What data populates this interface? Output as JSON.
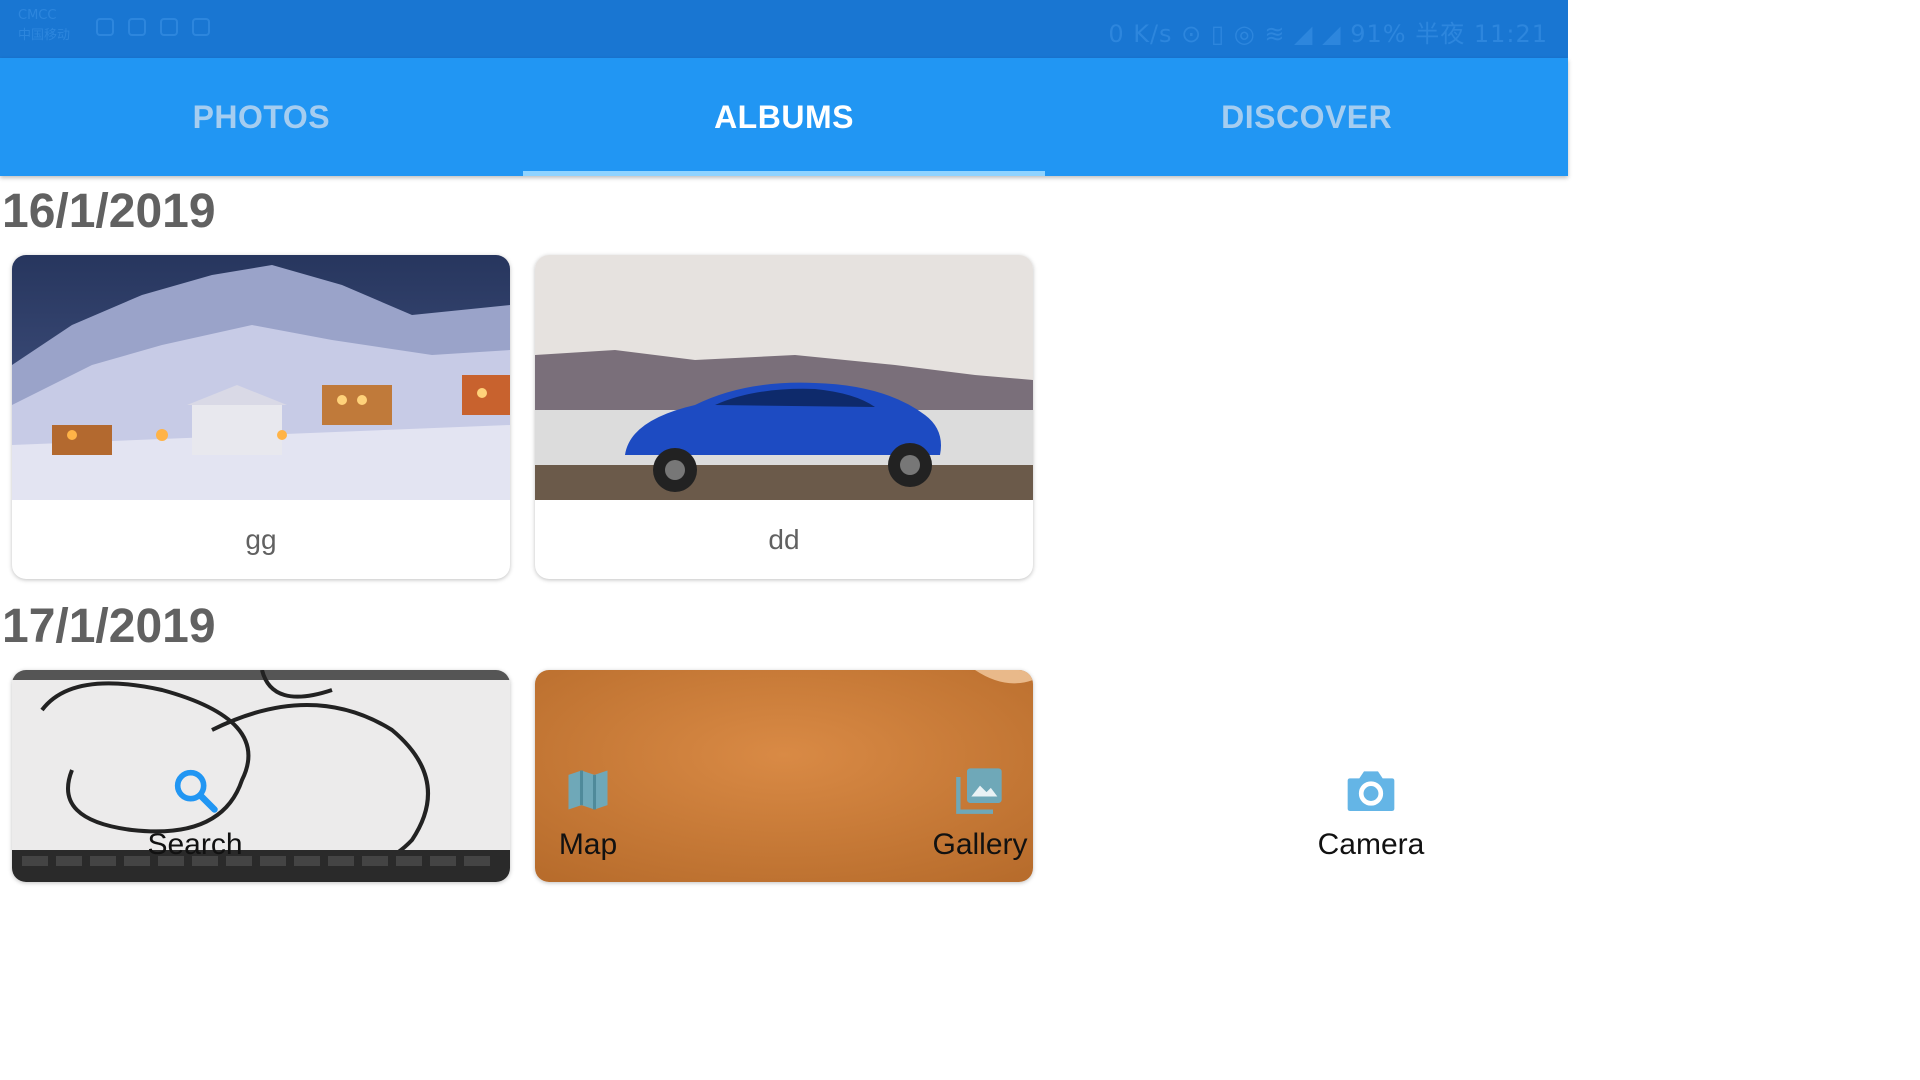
{
  "status_bar": {
    "carrier_line1": "CMCC",
    "carrier_line2": "中国移动",
    "right_text": "0 K/s  ⊙ ▯ ◎ ≋ ◢ ◢ 91% 半夜 11:21"
  },
  "tabs": [
    {
      "label": "PHOTOS",
      "active": false
    },
    {
      "label": "ALBUMS",
      "active": true
    },
    {
      "label": "DISCOVER",
      "active": false
    }
  ],
  "sections": [
    {
      "date": "16/1/2019",
      "albums": [
        {
          "name": "gg",
          "thumbnail": "snowy-village-night"
        },
        {
          "name": "dd",
          "thumbnail": "blue-car-lake"
        }
      ]
    },
    {
      "date": "17/1/2019",
      "albums": [
        {
          "name": "",
          "thumbnail": "keyboard-cable"
        },
        {
          "name": "",
          "thumbnail": "orange-surface"
        }
      ]
    }
  ],
  "bottom_nav": [
    {
      "label": "Search",
      "icon": "search-icon",
      "color": "#2196F3"
    },
    {
      "label": "Map",
      "icon": "map-icon",
      "color": "#6fa8b8"
    },
    {
      "label": "Gallery",
      "icon": "gallery-icon",
      "color": "#6fa8b8"
    },
    {
      "label": "Camera",
      "icon": "camera-icon",
      "color": "#64b5e6"
    }
  ]
}
